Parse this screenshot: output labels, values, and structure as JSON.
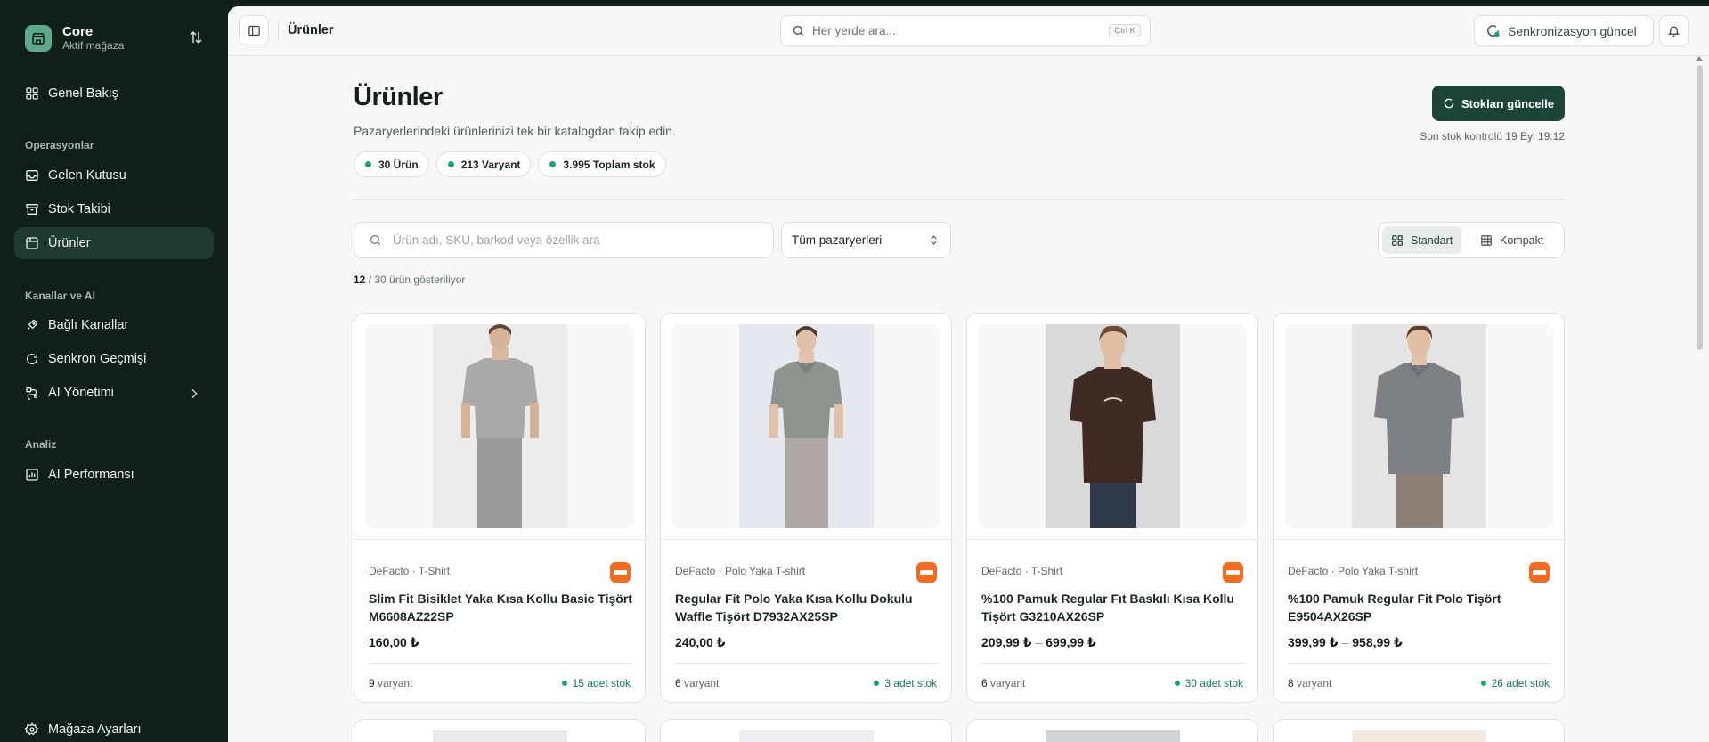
{
  "brand": {
    "name": "Core",
    "subtitle": "Aktif mağaza"
  },
  "sidebar": {
    "top_item": "Genel Bakış",
    "sections": [
      {
        "title": "Operasyonlar",
        "items": [
          "Gelen Kutusu",
          "Stok Takibi",
          "Ürünler"
        ]
      },
      {
        "title": "Kanallar ve AI",
        "items": [
          "Bağlı Kanallar",
          "Senkron Geçmişi",
          "AI Yönetimi"
        ]
      },
      {
        "title": "Analiz",
        "items": [
          "AI Performansı"
        ]
      }
    ],
    "active_item": "Ürünler",
    "footer_item": "Mağaza Ayarları"
  },
  "topbar": {
    "breadcrumb": "Ürünler",
    "search_placeholder": "Her yerde ara...",
    "search_shortcut": "Ctrl K",
    "sync_label": "Senkronizasyon güncel"
  },
  "page": {
    "title": "Ürünler",
    "subtitle": "Pazaryerlerindeki ürünlerinizi tek bir katalogdan takip edin.",
    "stats": [
      "30 Ürün",
      "213 Varyant",
      "3.995 Toplam stok"
    ],
    "primary_button": "Stokları güncelle",
    "last_check": "Son stok kontrolü 19 Eyl 19:12"
  },
  "filters": {
    "search_placeholder": "Ürün adı, SKU, barkod veya özellik ara",
    "marketplace": "Tüm pazaryerleri",
    "view_standard": "Standart",
    "view_compact": "Kompakt",
    "shown": "12",
    "shown_suffix": " / 30 ürün gösteriliyor"
  },
  "colors": {
    "accent": "#1c4538",
    "stock_green": "#18a374",
    "marketplace_badge": "#f46a1e"
  },
  "products": [
    {
      "meta": "DeFacto · T-Shirt",
      "title": "Slim Fit Bisiklet Yaka Kısa Kollu Basic Tişört M6608AZ22SP",
      "price": "160,00 ₺",
      "price_max": "",
      "variants": "9",
      "variant_suffix": " varyant",
      "stock": "15 adet stok",
      "shirt_color": "#a9aaa8",
      "bg": "#ececeb"
    },
    {
      "meta": "DeFacto · Polo Yaka T-shirt",
      "title": "Regular Fit Polo Yaka Kısa Kollu Dokulu Waffle Tişört D7932AX25SP",
      "price": "240,00 ₺",
      "price_max": "",
      "variants": "6",
      "variant_suffix": " varyant",
      "stock": "3 adet stok",
      "shirt_color": "#8f938e",
      "bg": "#e6e8f0"
    },
    {
      "meta": "DeFacto · T-Shirt",
      "title": "%100 Pamuk Regular Fıt Baskılı Kısa Kollu Tişört G3210AX26SP",
      "price": "209,99 ₺",
      "price_max": "699,99 ₺",
      "variants": "6",
      "variant_suffix": " varyant",
      "stock": "30 adet stok",
      "shirt_color": "#3e2c24",
      "bg": "#d9d9d9"
    },
    {
      "meta": "DeFacto · Polo Yaka T-shirt",
      "title": "%100 Pamuk Regular Fit Polo Tişört E9504AX26SP",
      "price": "399,99 ₺",
      "price_max": "958,99 ₺",
      "variants": "8",
      "variant_suffix": " varyant",
      "stock": "26 adet stok",
      "shirt_color": "#7d8084",
      "bg": "#e4e4e4"
    }
  ]
}
